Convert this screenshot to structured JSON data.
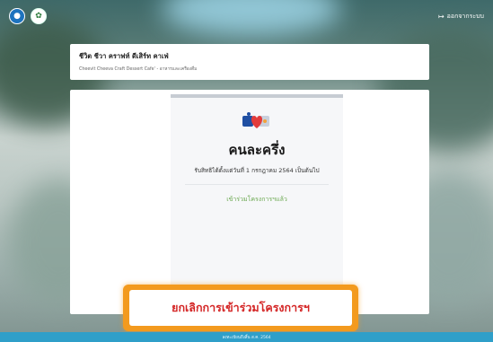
{
  "header": {
    "logout_label": "ออกจากระบบ"
  },
  "shop": {
    "name": "ชีวิต ชีวา คราฟท์ ดีเสิร์ท คาเฟ่",
    "subtitle": "Cheevit Cheeva Craft Dessert Cafe' - อาหารและเครื่องดื่ม"
  },
  "program": {
    "name": "คนละครึ่ง",
    "description": "รับสิทธิได้ตั้งแต่วันที่ 1 กรกฎาคม 2564 เป็นต้นไป",
    "status": "เข้าร่วมโครงการฯแล้ว"
  },
  "actions": {
    "cancel_label": "ยกเลิกการเข้าร่วมโครงการฯ"
  },
  "footer": {
    "text": "ลงทะเบียนถึงสิ้น ส.ค. 2564"
  },
  "colors": {
    "accent_green": "#6aa84f",
    "cancel_red": "#d42525",
    "highlight_orange": "#f39a1e",
    "footer_blue": "#2f9fc9"
  }
}
